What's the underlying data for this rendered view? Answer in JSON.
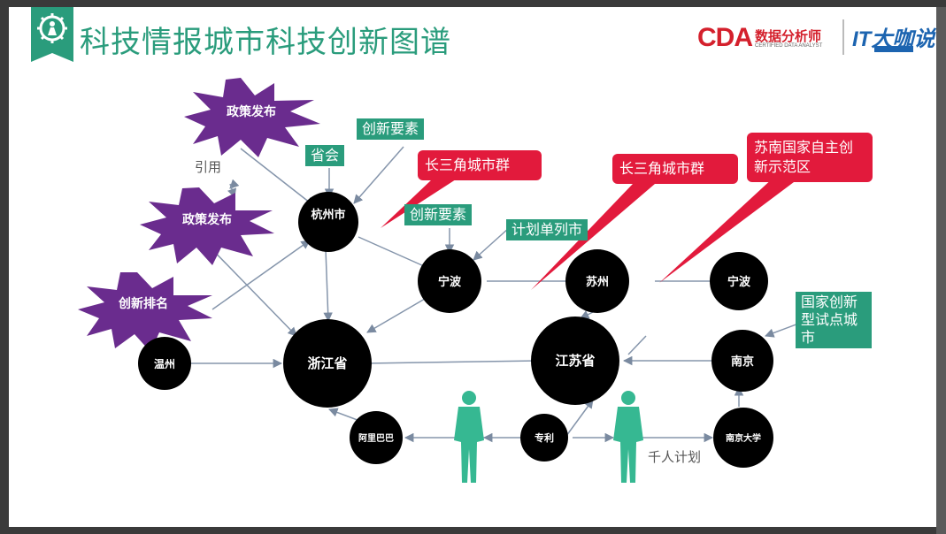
{
  "slide": {
    "title": "科技情报城市科技创新图谱"
  },
  "logos": {
    "cda": "CDA",
    "cda_cn": "数据分析师",
    "cda_sub": "CERTIFIED DATA ANALYST",
    "it": "IT大咖说"
  },
  "colors": {
    "accent_green": "#2a9c7c",
    "callout_red": "#e21a3c",
    "burst_purple": "#6a2c8e",
    "node_black": "#000000",
    "person_teal": "#36b892"
  },
  "nodes": {
    "hangzhou": "杭州市",
    "zhejiang": "浙江省",
    "ningbo_1": "宁波",
    "suzhou": "苏州",
    "ningbo_2": "宁波",
    "jiangsu": "江苏省",
    "nanjing": "南京",
    "wenzhou": "温州",
    "alibaba": "阿里巴巴",
    "patent": "专利",
    "nju": "南京大学"
  },
  "bursts": {
    "policy_1": "政策发布",
    "policy_2": "政策发布",
    "ranking": "创新排名"
  },
  "tags": {
    "province_meeting": "省会",
    "innovation_elements_1": "创新要素",
    "innovation_elements_2": "创新要素",
    "plan_city": "计划单列市",
    "national_pilot": "国家创新型试点城市"
  },
  "callouts": {
    "yrd_1": "长三角城市群",
    "yrd_2": "长三角城市群",
    "sunan": "苏南国家自主创新示范区"
  },
  "edge_labels": {
    "cite": "引用",
    "thousand_talents": "千人计划"
  },
  "icons": [
    "person-icon",
    "person-icon"
  ]
}
